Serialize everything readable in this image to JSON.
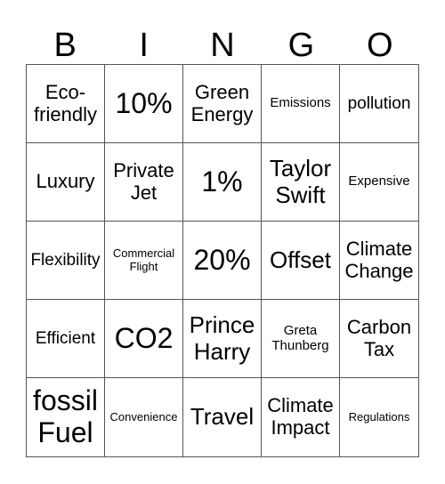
{
  "header": {
    "letters": [
      "B",
      "I",
      "N",
      "G",
      "O"
    ]
  },
  "cells": [
    {
      "text": "Eco-\nfriendly",
      "size": "lg"
    },
    {
      "text": "10%",
      "size": "xxl"
    },
    {
      "text": "Green\nEnergy",
      "size": "lg"
    },
    {
      "text": "Emissions",
      "size": "sm"
    },
    {
      "text": "pollution",
      "size": "md"
    },
    {
      "text": "Luxury",
      "size": "lg"
    },
    {
      "text": "Private\nJet",
      "size": "lg"
    },
    {
      "text": "1%",
      "size": "xxl"
    },
    {
      "text": "Taylor\nSwift",
      "size": "xl"
    },
    {
      "text": "Expensive",
      "size": "sm"
    },
    {
      "text": "Flexibility",
      "size": "md"
    },
    {
      "text": "Commercial\nFlight",
      "size": "xs"
    },
    {
      "text": "20%",
      "size": "xxl"
    },
    {
      "text": "Offset",
      "size": "xl"
    },
    {
      "text": "Climate\nChange",
      "size": "lg"
    },
    {
      "text": "Efficient",
      "size": "md"
    },
    {
      "text": "CO2",
      "size": "xxl"
    },
    {
      "text": "Prince\nHarry",
      "size": "xl"
    },
    {
      "text": "Greta\nThunberg",
      "size": "sm"
    },
    {
      "text": "Carbon\nTax",
      "size": "lg"
    },
    {
      "text": "fossil\nFuel",
      "size": "xxl"
    },
    {
      "text": "Convenience",
      "size": "xs"
    },
    {
      "text": "Travel",
      "size": "xl"
    },
    {
      "text": "Climate\nImpact",
      "size": "lg"
    },
    {
      "text": "Regulations",
      "size": "xs"
    }
  ]
}
